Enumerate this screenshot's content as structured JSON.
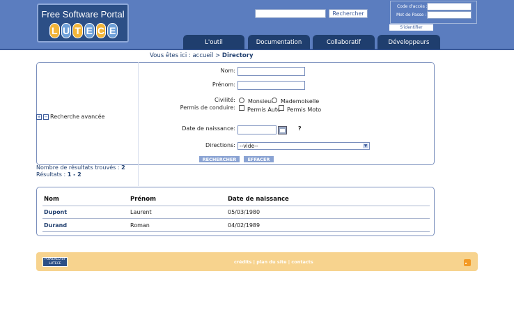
{
  "header": {
    "portal_title": "Free Software Portal",
    "logo_letters": [
      "L",
      "U",
      "T",
      "E",
      "C",
      "E"
    ],
    "search_button": "Rechercher",
    "login": {
      "code_label": "Code d'accès :",
      "password_label": "Mot de Passe :",
      "identify_link": "S'identifier"
    },
    "tabs": [
      "L'outil",
      "Documentation",
      "Collaboratif",
      "Développeurs"
    ]
  },
  "breadcrumb": {
    "prefix": "Vous êtes ici : accueil > ",
    "current": "Directory"
  },
  "search_form": {
    "advanced_link": "Recherche avancée",
    "nom_label": "Nom:",
    "prenom_label": "Prénom:",
    "civilite_label": "Civilité:",
    "civilite_options": [
      "Monsieur",
      "Mademoiselle"
    ],
    "permis_label": "Permis de conduire:",
    "permis_options": [
      "Permis Auto",
      "Permis Moto"
    ],
    "date_label": "Date de naissance:",
    "help_mark": "?",
    "directions_label": "Directions:",
    "directions_value": "--vide--",
    "search_button": "RECHERCHER",
    "clear_button": "EFFACER"
  },
  "results": {
    "count_text": "Nombre de résultats trouvés : ",
    "count": "2",
    "range_text": "Résultats : ",
    "range": "1 - 2"
  },
  "table": {
    "headers": [
      "Nom",
      "Prénom",
      "Date de naissance"
    ],
    "rows": [
      {
        "nom": "Dupont",
        "prenom": "Laurent",
        "date": "05/03/1980"
      },
      {
        "nom": "Durand",
        "prenom": "Roman",
        "date": "04/02/1989"
      }
    ]
  },
  "footer": {
    "powered_text": "POWERED BY",
    "powered_brand": "LUTECE",
    "links": "crédits | plan du site | contacts"
  },
  "colors": {
    "header_bg": "#5b7dbf",
    "tab_bg": "#1f3e6e",
    "footer_bg": "#f7d38e"
  }
}
